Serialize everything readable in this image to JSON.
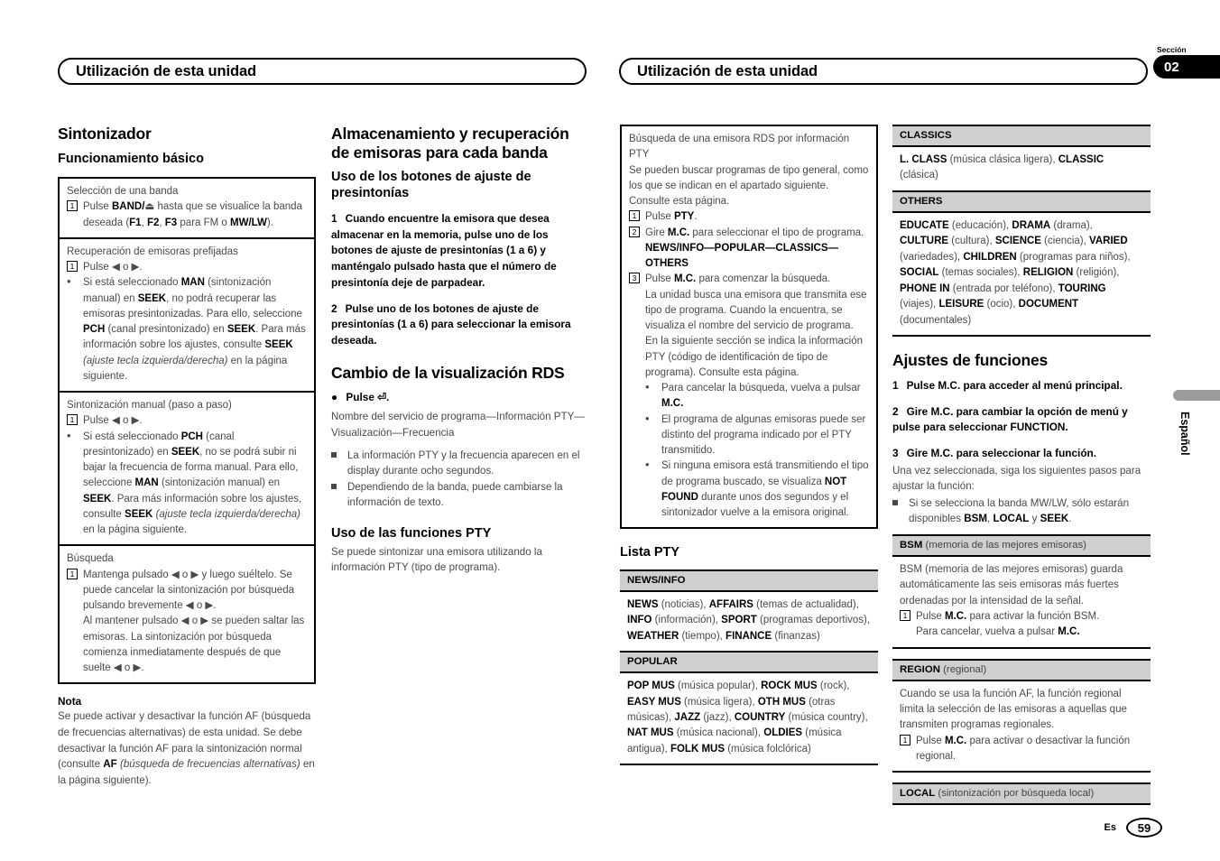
{
  "header": {
    "left_title": "Utilización de esta unidad",
    "right_title": "Utilización de esta unidad",
    "section_label": "Sección",
    "section_number": "02",
    "language_tab": "Español"
  },
  "footer": {
    "language_code": "Es",
    "page_number": "59"
  },
  "col1": {
    "section_title": "Sintonizador",
    "sub_title": "Funcionamiento básico",
    "table": [
      {
        "title": "Selección de una banda",
        "items": [
          {
            "marker": "1",
            "text_1": "Pulse ",
            "bold_1": "BAND/",
            "icon": "⏏",
            "text_2": " hasta que se visualice la banda deseada (",
            "bold_2": "F1",
            "text_3": ", ",
            "bold_3": "F2",
            "text_4": ", ",
            "bold_4": "F3",
            "text_5": " para FM o ",
            "bold_5": "MW/LW",
            "text_6": ")."
          }
        ]
      },
      {
        "title": "Recuperación de emisoras prefijadas",
        "items": [
          {
            "marker": "1",
            "text": "Pulse ◀ o ▶."
          },
          {
            "marker": "•",
            "segments": [
              {
                "t": "Si está seleccionado ",
                "s": "n"
              },
              {
                "t": "MAN",
                "s": "b"
              },
              {
                "t": " (sintonización manual) en ",
                "s": "n"
              },
              {
                "t": "SEEK",
                "s": "b"
              },
              {
                "t": ", no podrá recuperar las emisoras presintonizadas. Para ello, seleccione ",
                "s": "n"
              },
              {
                "t": "PCH",
                "s": "b"
              },
              {
                "t": " (canal presintonizado) en ",
                "s": "n"
              },
              {
                "t": "SEEK",
                "s": "b"
              },
              {
                "t": ". Para más información sobre los ajustes, consulte ",
                "s": "n"
              },
              {
                "t": "SEEK",
                "s": "b"
              },
              {
                "t": " ",
                "s": "n"
              },
              {
                "t": "(ajuste tecla izquierda/derecha)",
                "s": "i"
              },
              {
                "t": " en la página siguiente.",
                "s": "n"
              }
            ]
          }
        ]
      },
      {
        "title": "Sintonización manual (paso a paso)",
        "items": [
          {
            "marker": "1",
            "text": "Pulse ◀ o ▶."
          },
          {
            "marker": "•",
            "segments": [
              {
                "t": "Si está seleccionado ",
                "s": "n"
              },
              {
                "t": "PCH",
                "s": "b"
              },
              {
                "t": " (canal presintonizado) en ",
                "s": "n"
              },
              {
                "t": "SEEK",
                "s": "b"
              },
              {
                "t": ", no se podrá subir ni bajar la frecuencia de forma manual. Para ello, seleccione ",
                "s": "n"
              },
              {
                "t": "MAN",
                "s": "b"
              },
              {
                "t": " (sintonización manual) en ",
                "s": "n"
              },
              {
                "t": "SEEK",
                "s": "b"
              },
              {
                "t": ". Para más información sobre los ajustes, consulte ",
                "s": "n"
              },
              {
                "t": "SEEK",
                "s": "b"
              },
              {
                "t": " ",
                "s": "n"
              },
              {
                "t": "(ajuste tecla izquierda/derecha)",
                "s": "i"
              },
              {
                "t": " en la página siguiente.",
                "s": "n"
              }
            ]
          }
        ]
      },
      {
        "title": "Búsqueda",
        "items": [
          {
            "marker": "1",
            "text": "Mantenga pulsado ◀ o ▶ y luego suéltelo. Se puede cancelar la sintonización por búsqueda pulsando brevemente ◀ o ▶."
          },
          {
            "marker": "",
            "text": "Al mantener pulsado ◀ o ▶ se pueden saltar las emisoras. La sintonización por búsqueda comienza inmediatamente después de que suelte ◀ o ▶."
          }
        ]
      }
    ],
    "note_head": "Nota",
    "note_segments": [
      {
        "t": "Se puede activar y desactivar la función AF (búsqueda de frecuencias alternativas) de esta unidad. Se debe desactivar la función AF para la sintonización normal (consulte ",
        "s": "n"
      },
      {
        "t": "AF",
        "s": "b"
      },
      {
        "t": " ",
        "s": "n"
      },
      {
        "t": "(búsqueda de frecuencias alternativas)",
        "s": "i"
      },
      {
        "t": " en la página siguiente).",
        "s": "n"
      }
    ]
  },
  "col2": {
    "section_title": "Almacenamiento y recuperación de emisoras para cada banda",
    "sub_title": "Uso de los botones de ajuste de presintonías",
    "step1_num": "1",
    "step1_text": "Cuando encuentre la emisora que desea almacenar en la memoria, pulse uno de los botones de ajuste de presintonías (1 a 6) y manténgalo pulsado hasta que el número de presintonía deje de parpadear.",
    "step2_num": "2",
    "step2_text": "Pulse uno de los botones de ajuste de presintonías (1 a 6) para seleccionar la emisora deseada.",
    "rds_title": "Cambio de la visualización RDS",
    "rds_bullet": "● ",
    "rds_press": "Pulse ⏎.",
    "rds_sequence": "Nombre del servicio de programa—Información PTY—Visualización—Frecuencia",
    "rds_notes": [
      "La información PTY y la frecuencia aparecen en el display durante ocho segundos.",
      "Dependiendo de la banda, puede cambiarse la información de texto."
    ],
    "pty_title": "Uso de las funciones PTY",
    "pty_text": "Se puede sintonizar una emisora utilizando la información PTY (tipo de programa)."
  },
  "col3": {
    "box": {
      "title": "Búsqueda de una emisora RDS por información PTY",
      "intro": "Se pueden buscar programas de tipo general, como los que se indican en el apartado siguiente. Consulte esta página.",
      "step1_marker": "1",
      "step1_segments": [
        {
          "t": "Pulse ",
          "s": "n"
        },
        {
          "t": "PTY",
          "s": "b"
        },
        {
          "t": ".",
          "s": "n"
        }
      ],
      "step2_marker": "2",
      "step2_segments": [
        {
          "t": "Gire ",
          "s": "n"
        },
        {
          "t": "M.C.",
          "s": "b"
        },
        {
          "t": " para seleccionar el tipo de programa.",
          "s": "n"
        }
      ],
      "step2_chain": "NEWS/INFO—POPULAR—CLASSICS—OTHERS",
      "step3_marker": "3",
      "step3_segments": [
        {
          "t": "Pulse ",
          "s": "n"
        },
        {
          "t": "M.C.",
          "s": "b"
        },
        {
          "t": " para comenzar la búsqueda.",
          "s": "n"
        }
      ],
      "step3_body": "La unidad busca una emisora que transmita ese tipo de programa. Cuando la encuentra, se visualiza el nombre del servicio de programa.",
      "step3_body2": "En la siguiente sección se indica la información PTY (código de identificación de tipo de programa). Consulte esta página.",
      "bullets": [
        [
          {
            "t": "Para cancelar la búsqueda, vuelva a pulsar ",
            "s": "n"
          },
          {
            "t": "M.C.",
            "s": "b"
          }
        ],
        [
          {
            "t": "El programa de algunas emisoras puede ser distinto del programa indicado por el PTY transmitido.",
            "s": "n"
          }
        ],
        [
          {
            "t": "Si ninguna emisora está transmitiendo el tipo de programa buscado, se visualiza ",
            "s": "n"
          },
          {
            "t": "NOT FOUND",
            "s": "b"
          },
          {
            "t": " durante unos dos segundos y el sintonizador vuelve a la emisora original.",
            "s": "n"
          }
        ]
      ]
    },
    "list_title": "Lista PTY",
    "tables": [
      {
        "header": "NEWS/INFO",
        "segments": [
          {
            "t": "NEWS",
            "s": "b"
          },
          {
            "t": " (noticias), ",
            "s": "n"
          },
          {
            "t": "AFFAIRS",
            "s": "b"
          },
          {
            "t": " (temas de actualidad), ",
            "s": "n"
          },
          {
            "t": "INFO",
            "s": "b"
          },
          {
            "t": " (información), ",
            "s": "n"
          },
          {
            "t": "SPORT",
            "s": "b"
          },
          {
            "t": " (programas deportivos), ",
            "s": "n"
          },
          {
            "t": "WEATHER",
            "s": "b"
          },
          {
            "t": " (tiempo), ",
            "s": "n"
          },
          {
            "t": "FINANCE",
            "s": "b"
          },
          {
            "t": " (finanzas)",
            "s": "n"
          }
        ]
      },
      {
        "header": "POPULAR",
        "segments": [
          {
            "t": "POP MUS",
            "s": "b"
          },
          {
            "t": " (música popular), ",
            "s": "n"
          },
          {
            "t": "ROCK MUS",
            "s": "b"
          },
          {
            "t": " (rock), ",
            "s": "n"
          },
          {
            "t": "EASY MUS",
            "s": "b"
          },
          {
            "t": " (música ligera), ",
            "s": "n"
          },
          {
            "t": "OTH MUS",
            "s": "b"
          },
          {
            "t": " (otras músicas), ",
            "s": "n"
          },
          {
            "t": "JAZZ",
            "s": "b"
          },
          {
            "t": " (jazz), ",
            "s": "n"
          },
          {
            "t": "COUNTRY",
            "s": "b"
          },
          {
            "t": " (música country), ",
            "s": "n"
          },
          {
            "t": "NAT MUS",
            "s": "b"
          },
          {
            "t": " (música nacional), ",
            "s": "n"
          },
          {
            "t": "OLDIES",
            "s": "b"
          },
          {
            "t": " (música antigua), ",
            "s": "n"
          },
          {
            "t": "FOLK MUS",
            "s": "b"
          },
          {
            "t": " (música folclórica)",
            "s": "n"
          }
        ]
      }
    ]
  },
  "col4": {
    "tables": [
      {
        "header": "CLASSICS",
        "segments": [
          {
            "t": "L. CLASS",
            "s": "b"
          },
          {
            "t": " (música clásica ligera), ",
            "s": "n"
          },
          {
            "t": "CLASSIC",
            "s": "b"
          },
          {
            "t": " (clásica)",
            "s": "n"
          }
        ]
      },
      {
        "header": "OTHERS",
        "segments": [
          {
            "t": "EDUCATE",
            "s": "b"
          },
          {
            "t": " (educación), ",
            "s": "n"
          },
          {
            "t": "DRAMA",
            "s": "b"
          },
          {
            "t": " (drama), ",
            "s": "n"
          },
          {
            "t": "CULTURE",
            "s": "b"
          },
          {
            "t": " (cultura), ",
            "s": "n"
          },
          {
            "t": "SCIENCE",
            "s": "b"
          },
          {
            "t": " (ciencia), ",
            "s": "n"
          },
          {
            "t": "VARIED",
            "s": "b"
          },
          {
            "t": " (variedades), ",
            "s": "n"
          },
          {
            "t": "CHILDREN",
            "s": "b"
          },
          {
            "t": " (programas para niños), ",
            "s": "n"
          },
          {
            "t": "SOCIAL",
            "s": "b"
          },
          {
            "t": " (temas sociales), ",
            "s": "n"
          },
          {
            "t": "RELIGION",
            "s": "b"
          },
          {
            "t": " (religión), ",
            "s": "n"
          },
          {
            "t": "PHONE IN",
            "s": "b"
          },
          {
            "t": " (entrada por teléfono), ",
            "s": "n"
          },
          {
            "t": "TOURING",
            "s": "b"
          },
          {
            "t": " (viajes), ",
            "s": "n"
          },
          {
            "t": "LEISURE",
            "s": "b"
          },
          {
            "t": " (ocio), ",
            "s": "n"
          },
          {
            "t": "DOCUMENT",
            "s": "b"
          },
          {
            "t": " (documentales)",
            "s": "n"
          }
        ]
      }
    ],
    "section_title": "Ajustes de funciones",
    "step1_num": "1",
    "step1_text": "Pulse M.C. para acceder al menú principal.",
    "step2_num": "2",
    "step2_text": "Gire M.C. para cambiar la opción de menú y pulse para seleccionar FUNCTION.",
    "step3_num": "3",
    "step3_text": "Gire M.C. para seleccionar la función.",
    "step3_body": "Una vez seleccionada, siga los siguientes pasos para ajustar la función:",
    "step3_note_segments": [
      {
        "t": "Si se selecciona la banda MW/LW, sólo estarán disponibles ",
        "s": "n"
      },
      {
        "t": "BSM",
        "s": "b"
      },
      {
        "t": ", ",
        "s": "n"
      },
      {
        "t": "LOCAL",
        "s": "b"
      },
      {
        "t": " y ",
        "s": "n"
      },
      {
        "t": "SEEK",
        "s": "b"
      },
      {
        "t": ".",
        "s": "n"
      }
    ],
    "func_tables": [
      {
        "header_bold": "BSM",
        "header_light": " (memoria de las mejores emisoras)",
        "body": "BSM (memoria de las mejores emisoras) guarda automáticamente las seis emisoras más fuertes ordenadas por la intensidad de la señal.",
        "steps": [
          {
            "marker": "1",
            "segments": [
              {
                "t": "Pulse ",
                "s": "n"
              },
              {
                "t": "M.C.",
                "s": "b"
              },
              {
                "t": " para activar la función BSM.",
                "s": "n"
              }
            ]
          },
          {
            "marker": "",
            "segments": [
              {
                "t": "Para cancelar, vuelva a pulsar ",
                "s": "n"
              },
              {
                "t": "M.C.",
                "s": "b"
              }
            ]
          }
        ]
      },
      {
        "header_bold": "REGION",
        "header_light": " (regional)",
        "body": "Cuando se usa la función AF, la función regional limita la selección de las emisoras a aquellas que transmiten programas regionales.",
        "steps": [
          {
            "marker": "1",
            "segments": [
              {
                "t": "Pulse ",
                "s": "n"
              },
              {
                "t": "M.C.",
                "s": "b"
              },
              {
                "t": " para activar o desactivar la función regional.",
                "s": "n"
              }
            ]
          }
        ]
      }
    ],
    "local_header_bold": "LOCAL",
    "local_header_light": " (sintonización por búsqueda local)"
  }
}
